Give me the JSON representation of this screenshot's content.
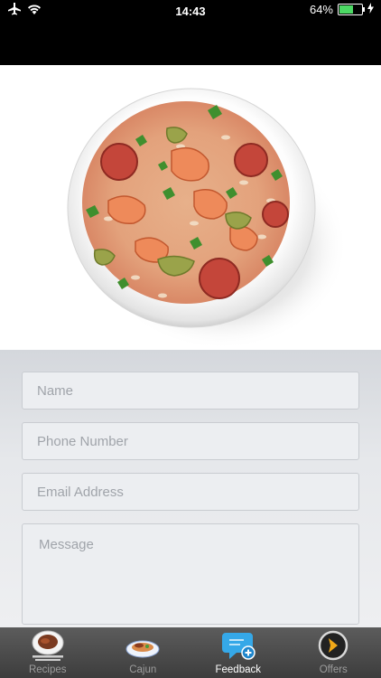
{
  "status_bar": {
    "time": "14:43",
    "battery_pct": "64%",
    "battery_level": 0.64,
    "icons": [
      "airplane-icon",
      "wifi-icon",
      "battery-icon",
      "charging-icon"
    ]
  },
  "hero": {
    "icon": "jambalaya-bowl-image"
  },
  "form": {
    "name_placeholder": "Name",
    "phone_placeholder": "Phone Number",
    "email_placeholder": "Email Address",
    "message_placeholder": "Message"
  },
  "tabbar": {
    "tabs": [
      {
        "label": "Recipes",
        "icon": "steak-plate-icon"
      },
      {
        "label": "Cajun",
        "icon": "cajun-plate-icon"
      },
      {
        "label": "Feedback",
        "icon": "chat-bubble-plus-icon"
      },
      {
        "label": "Offers",
        "icon": "chevron-circle-icon"
      }
    ],
    "active_index": 2,
    "active_color": "#ffffff",
    "inactive_color": "#9c9c9c"
  }
}
